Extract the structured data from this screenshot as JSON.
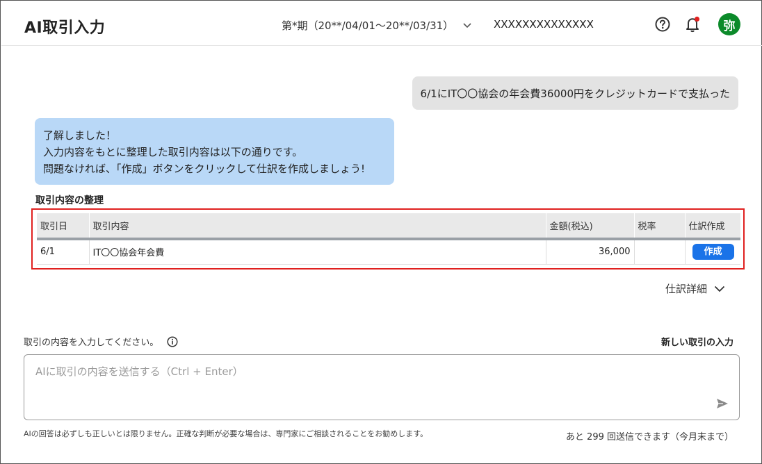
{
  "header": {
    "title": "AI取引入力",
    "period": "第*期（20**/04/01～20**/03/31）",
    "company": "XXXXXXXXXXXXXX",
    "avatar_char": "弥",
    "notification_dot_color": "#e0201f",
    "avatar_color": "#0c8a2a"
  },
  "chat": {
    "user_message": "6/1にIT〇〇協会の年会費36000円をクレジットカードで支払った",
    "ai_lines": [
      "了解しました！",
      "入力内容をもとに整理した取引内容は以下の通りです。",
      "問題なければ、「作成」ボタンをクリックして仕訳を作成しましょう!"
    ]
  },
  "summary": {
    "title": "取引内容の整理",
    "columns": [
      "取引日",
      "取引内容",
      "金額(税込)",
      "税率",
      "仕訳作成"
    ],
    "rows": [
      {
        "date": "6/1",
        "description": "IT〇〇協会年会費",
        "amount": "36,000",
        "tax_rate": "",
        "action_label": "作成"
      }
    ],
    "detail_toggle": "仕訳詳細"
  },
  "input": {
    "label": "取引の内容を入力してください。",
    "new_transaction": "新しい取引の入力",
    "placeholder": "AIに取引の内容を送信する（Ctrl + Enter）",
    "disclaimer": "AIの回答は必ずしも正しいとは限りません。正確な判断が必要な場合は、専門家にご相談されることをお勧めします。",
    "remaining": "あと 299 回送信できます（今月末まで）"
  },
  "colors": {
    "accent": "#1a73e8",
    "highlight_border": "#e0201f",
    "ai_bubble": "#b9d8f7",
    "user_bubble": "#e3e3e3"
  }
}
